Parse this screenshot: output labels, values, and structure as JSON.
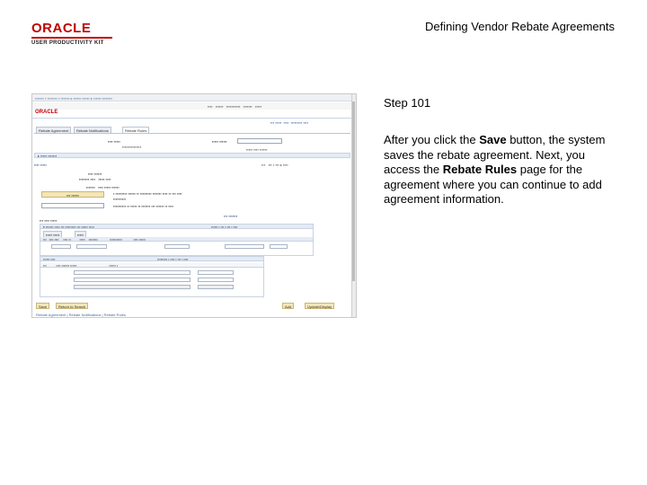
{
  "slide": {
    "title": "Defining Vendor Rebate Agreements",
    "logo_brand": "ORACLE",
    "logo_product": "USER PRODUCTIVITY KIT"
  },
  "step": {
    "title": "Step 101",
    "body_part1": "After you click the ",
    "body_bold1": "Save",
    "body_part2": " button, the system saves the rebate agreement. Next, you access the ",
    "body_bold2": "Rebate Rules",
    "body_part3": " page for the agreement where you can continue to add agreement information."
  },
  "screenshot": {
    "oracle_mini": "ORACLE",
    "tabs": [
      "Rebate Agreement",
      "Rebate Notifications",
      "Rebate Rules"
    ],
    "footer_links": "Rebate Agreement | Rebate Notifications | Rebate Rules",
    "save_button": "Save",
    "return_button": "Return to Search",
    "add_button": "Add",
    "update_button": "Update/Display"
  },
  "colors": {
    "brand_red": "#c00000",
    "nav_bg": "#eef1f5",
    "grid_header": "#e4ebf4"
  }
}
